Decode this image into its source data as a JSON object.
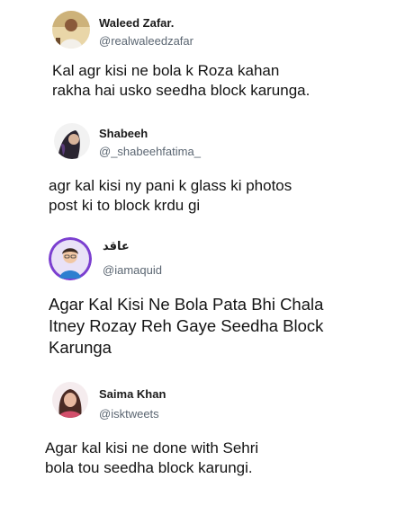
{
  "tweets": [
    {
      "display_name": "Waleed Zafar.",
      "handle": "@realwaleedzafar",
      "avatar_icon": "profile-photo-icon",
      "lines": [
        "Kal agr kisi ne bola k Roza kahan",
        "rakha hai usko seedha block karunga."
      ]
    },
    {
      "display_name": "Shabeeh",
      "handle": "@_shabeehfatima_",
      "avatar_icon": "profile-photo-icon",
      "lines": [
        "agr kal kisi ny pani k glass ki photos",
        "post ki to block krdu gi"
      ]
    },
    {
      "display_name": "عاقد",
      "handle": "@iamaquid",
      "avatar_icon": "profile-photo-icon",
      "lines": [
        "Agar Kal Kisi Ne Bola Pata Bhi Chala",
        "Itney Rozay Reh Gaye Seedha Block",
        "Karunga"
      ]
    },
    {
      "display_name": "Saima Khan",
      "handle": "@isktweets",
      "avatar_icon": "profile-photo-icon",
      "lines": [
        "Agar kal kisi ne done with Sehri",
        "bola tou seedha block karungi."
      ]
    }
  ],
  "colors": {
    "background": "#ffffff",
    "text": "#141414",
    "handle": "#5b6672"
  }
}
